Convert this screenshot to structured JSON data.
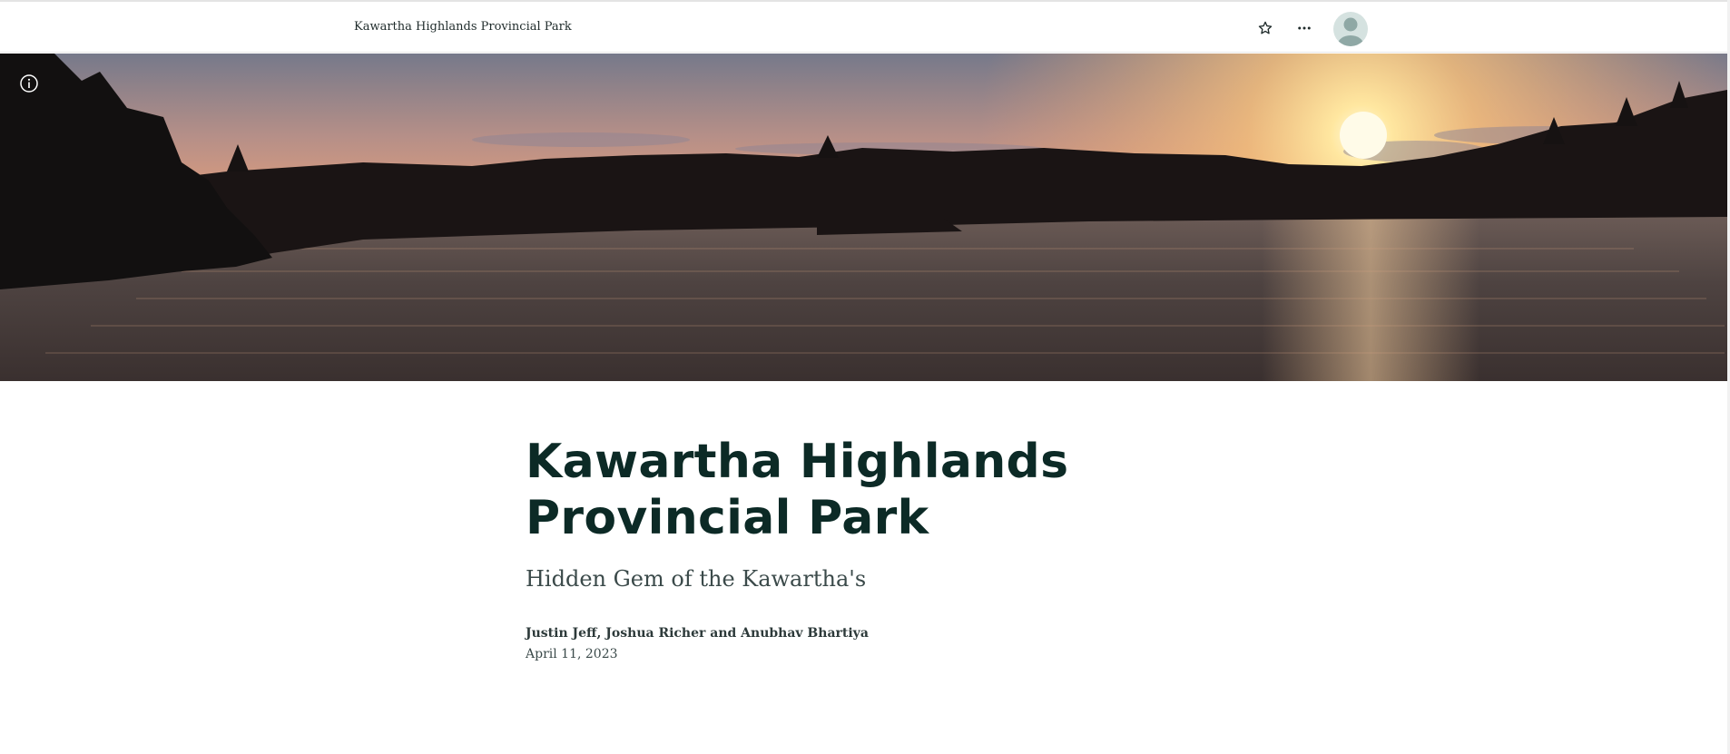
{
  "header": {
    "site_title": "Kawartha Highlands Provincial Park",
    "icons": {
      "favorite": "star-icon",
      "more": "more-options-icon",
      "account": "user-avatar-icon"
    }
  },
  "hero": {
    "image_description": "sunset-over-lake-icon",
    "info_icon": "info-icon"
  },
  "article": {
    "title": "Kawartha Highlands Provincial Park",
    "subtitle": "Hidden Gem of the Kawartha's",
    "authors": "Justin Jeff, Joshua Richer and Anubhav Bhartiya",
    "date": "April 11, 2023"
  },
  "colors": {
    "title_color": "#0c2a26",
    "text_color": "#3b4a4a",
    "avatar_bg": "#d5e2e0",
    "sky_top": "#7b7f8c",
    "sky_mid": "#e89a70",
    "sun": "#fff4a8"
  }
}
